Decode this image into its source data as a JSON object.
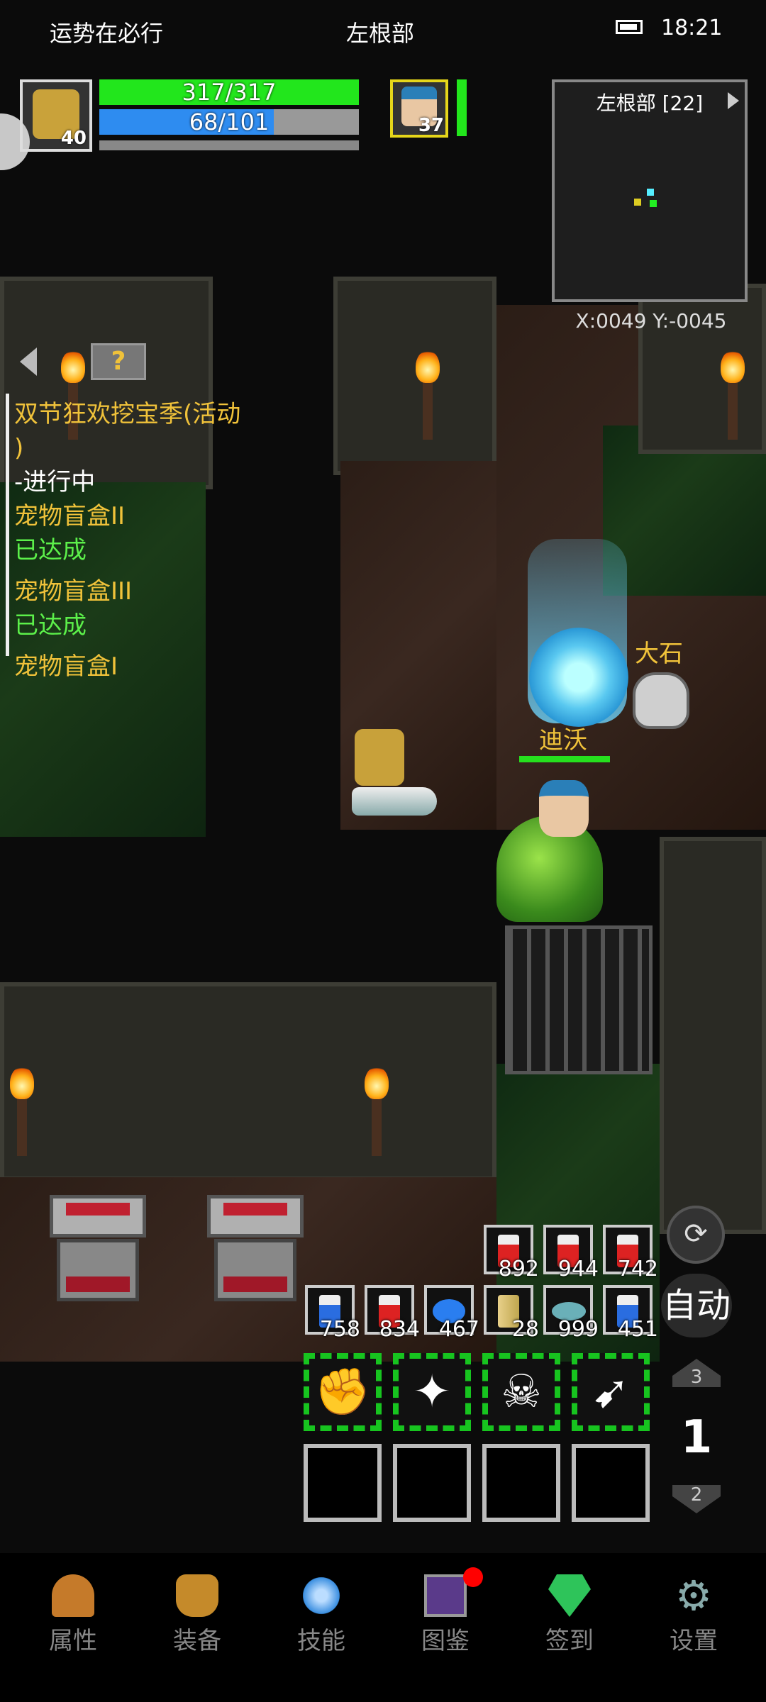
{
  "status_bar": {
    "carrier": "运势在必行",
    "location": "左根部",
    "time": "18:21"
  },
  "player": {
    "level": "40",
    "hp": "317/317",
    "mp": "68/101",
    "hp_fraction": 1.0,
    "mp_fraction": 0.673
  },
  "companion": {
    "level": "37"
  },
  "minimap": {
    "title": "左根部 [22]",
    "coords": "X:0049  Y:-0045"
  },
  "quest_panel": {
    "lines": [
      "双节狂欢挖宝季(活动",
      ")",
      "-进行中",
      "宠物盲盒II",
      "已达成",
      "宠物盲盒III",
      "已达成",
      "宠物盲盒I"
    ]
  },
  "npcs": {
    "rock_name": "大石",
    "pet_name": "迪沃"
  },
  "quick_items_top": [
    {
      "count": "892",
      "icon": "red-potion-icon"
    },
    {
      "count": "944",
      "icon": "red-potion-icon"
    },
    {
      "count": "742",
      "icon": "red-potion-icon"
    }
  ],
  "quick_items_bottom": [
    {
      "count": "758",
      "icon": "blue-potion-icon"
    },
    {
      "count": "834",
      "icon": "red-potion-icon"
    },
    {
      "count": "467",
      "icon": "blue-fish-icon"
    },
    {
      "count": "28",
      "icon": "scroll-icon"
    },
    {
      "count": "999",
      "icon": "fish-icon"
    },
    {
      "count": "451",
      "icon": "blue-potion-icon"
    }
  ],
  "controls": {
    "auto_label": "自动",
    "page_up": "3",
    "page_current": "1",
    "page_down": "2"
  },
  "skills": [
    {
      "icon": "fist-icon"
    },
    {
      "icon": "beast-icon"
    },
    {
      "icon": "horned-skull-icon"
    },
    {
      "icon": "rocket-icon"
    }
  ],
  "bottom_nav": [
    {
      "label": "属性",
      "icon": "helmet-icon"
    },
    {
      "label": "装备",
      "icon": "bag-icon"
    },
    {
      "label": "技能",
      "icon": "crystal-icon"
    },
    {
      "label": "图鉴",
      "icon": "book-icon"
    },
    {
      "label": "签到",
      "icon": "gem-icon"
    },
    {
      "label": "设置",
      "icon": "gear-icon"
    }
  ],
  "colors": {
    "hp": "#22e61c",
    "mp": "#2e8cf0",
    "quest": "#f0c23a",
    "done": "#5cf04a",
    "skill_border": "#17c41f"
  }
}
